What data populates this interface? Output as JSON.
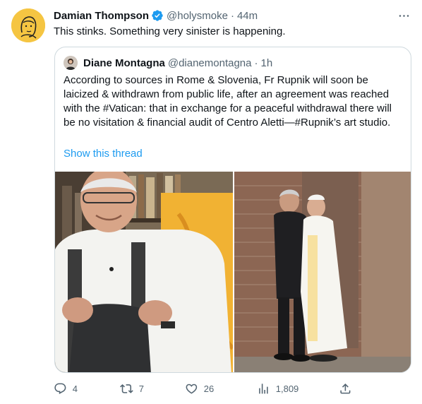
{
  "tweet": {
    "author_name": "Damian Thompson",
    "handle": "@holysmoke",
    "separator": "·",
    "time": "44m",
    "text": "This stinks. Something very sinister is happening.",
    "more_icon": "more-icon"
  },
  "quote": {
    "author_name": "Diane Montagna",
    "handle": "@dianemontagna",
    "separator": "·",
    "time": "1h",
    "text": "According to sources in Rome & Slovenia, Fr Rupnik will soon be laicized & withdrawn from public life, after an agreement was reached with the #Vatican: that in exchange for a peaceful withdrawal there will be no visitation & financial audit of Centro Aletti—#Rupnik’s art studio.",
    "show_thread": "Show this thread"
  },
  "actions": {
    "replies": "4",
    "retweets": "7",
    "likes": "26",
    "views": "1,809"
  },
  "colors": {
    "accent": "#1d9bf0",
    "secondary_text": "#536471",
    "border": "#cfd9de"
  }
}
